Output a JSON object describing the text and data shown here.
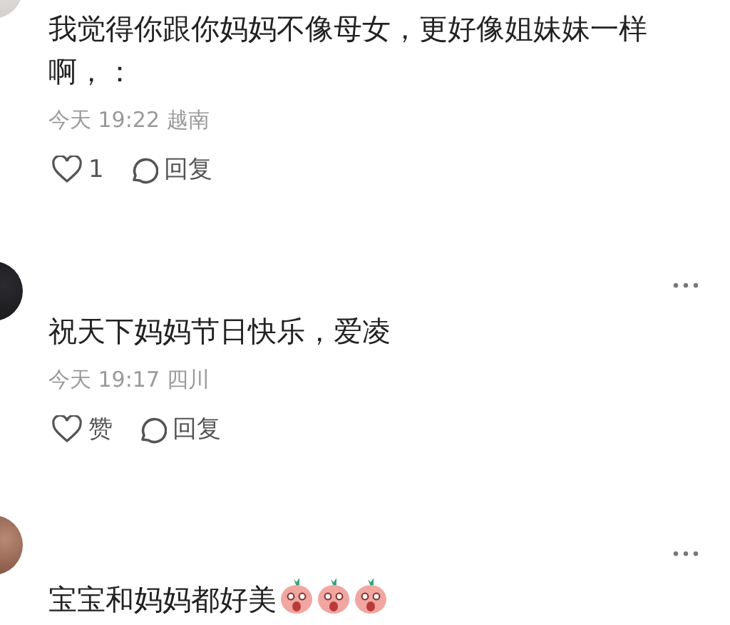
{
  "comments": [
    {
      "text": "我觉得你跟你妈妈不像母女，更好像姐妹妹一样啊，：",
      "show_more": false,
      "time": "今天 19:22",
      "location": "越南",
      "like_label": "1",
      "liked": false,
      "reply_label": "回复"
    },
    {
      "text": "祝天下妈妈节日快乐，爱凌",
      "show_more": true,
      "time": "今天 19:17",
      "location": "四川",
      "like_label": "赞",
      "liked": false,
      "reply_label": "回复"
    },
    {
      "text": "宝宝和妈妈都好美",
      "show_more": true,
      "emojis": [
        {
          "kind": "peach"
        },
        {
          "kind": "peach"
        },
        {
          "kind": "peach"
        }
      ]
    }
  ]
}
